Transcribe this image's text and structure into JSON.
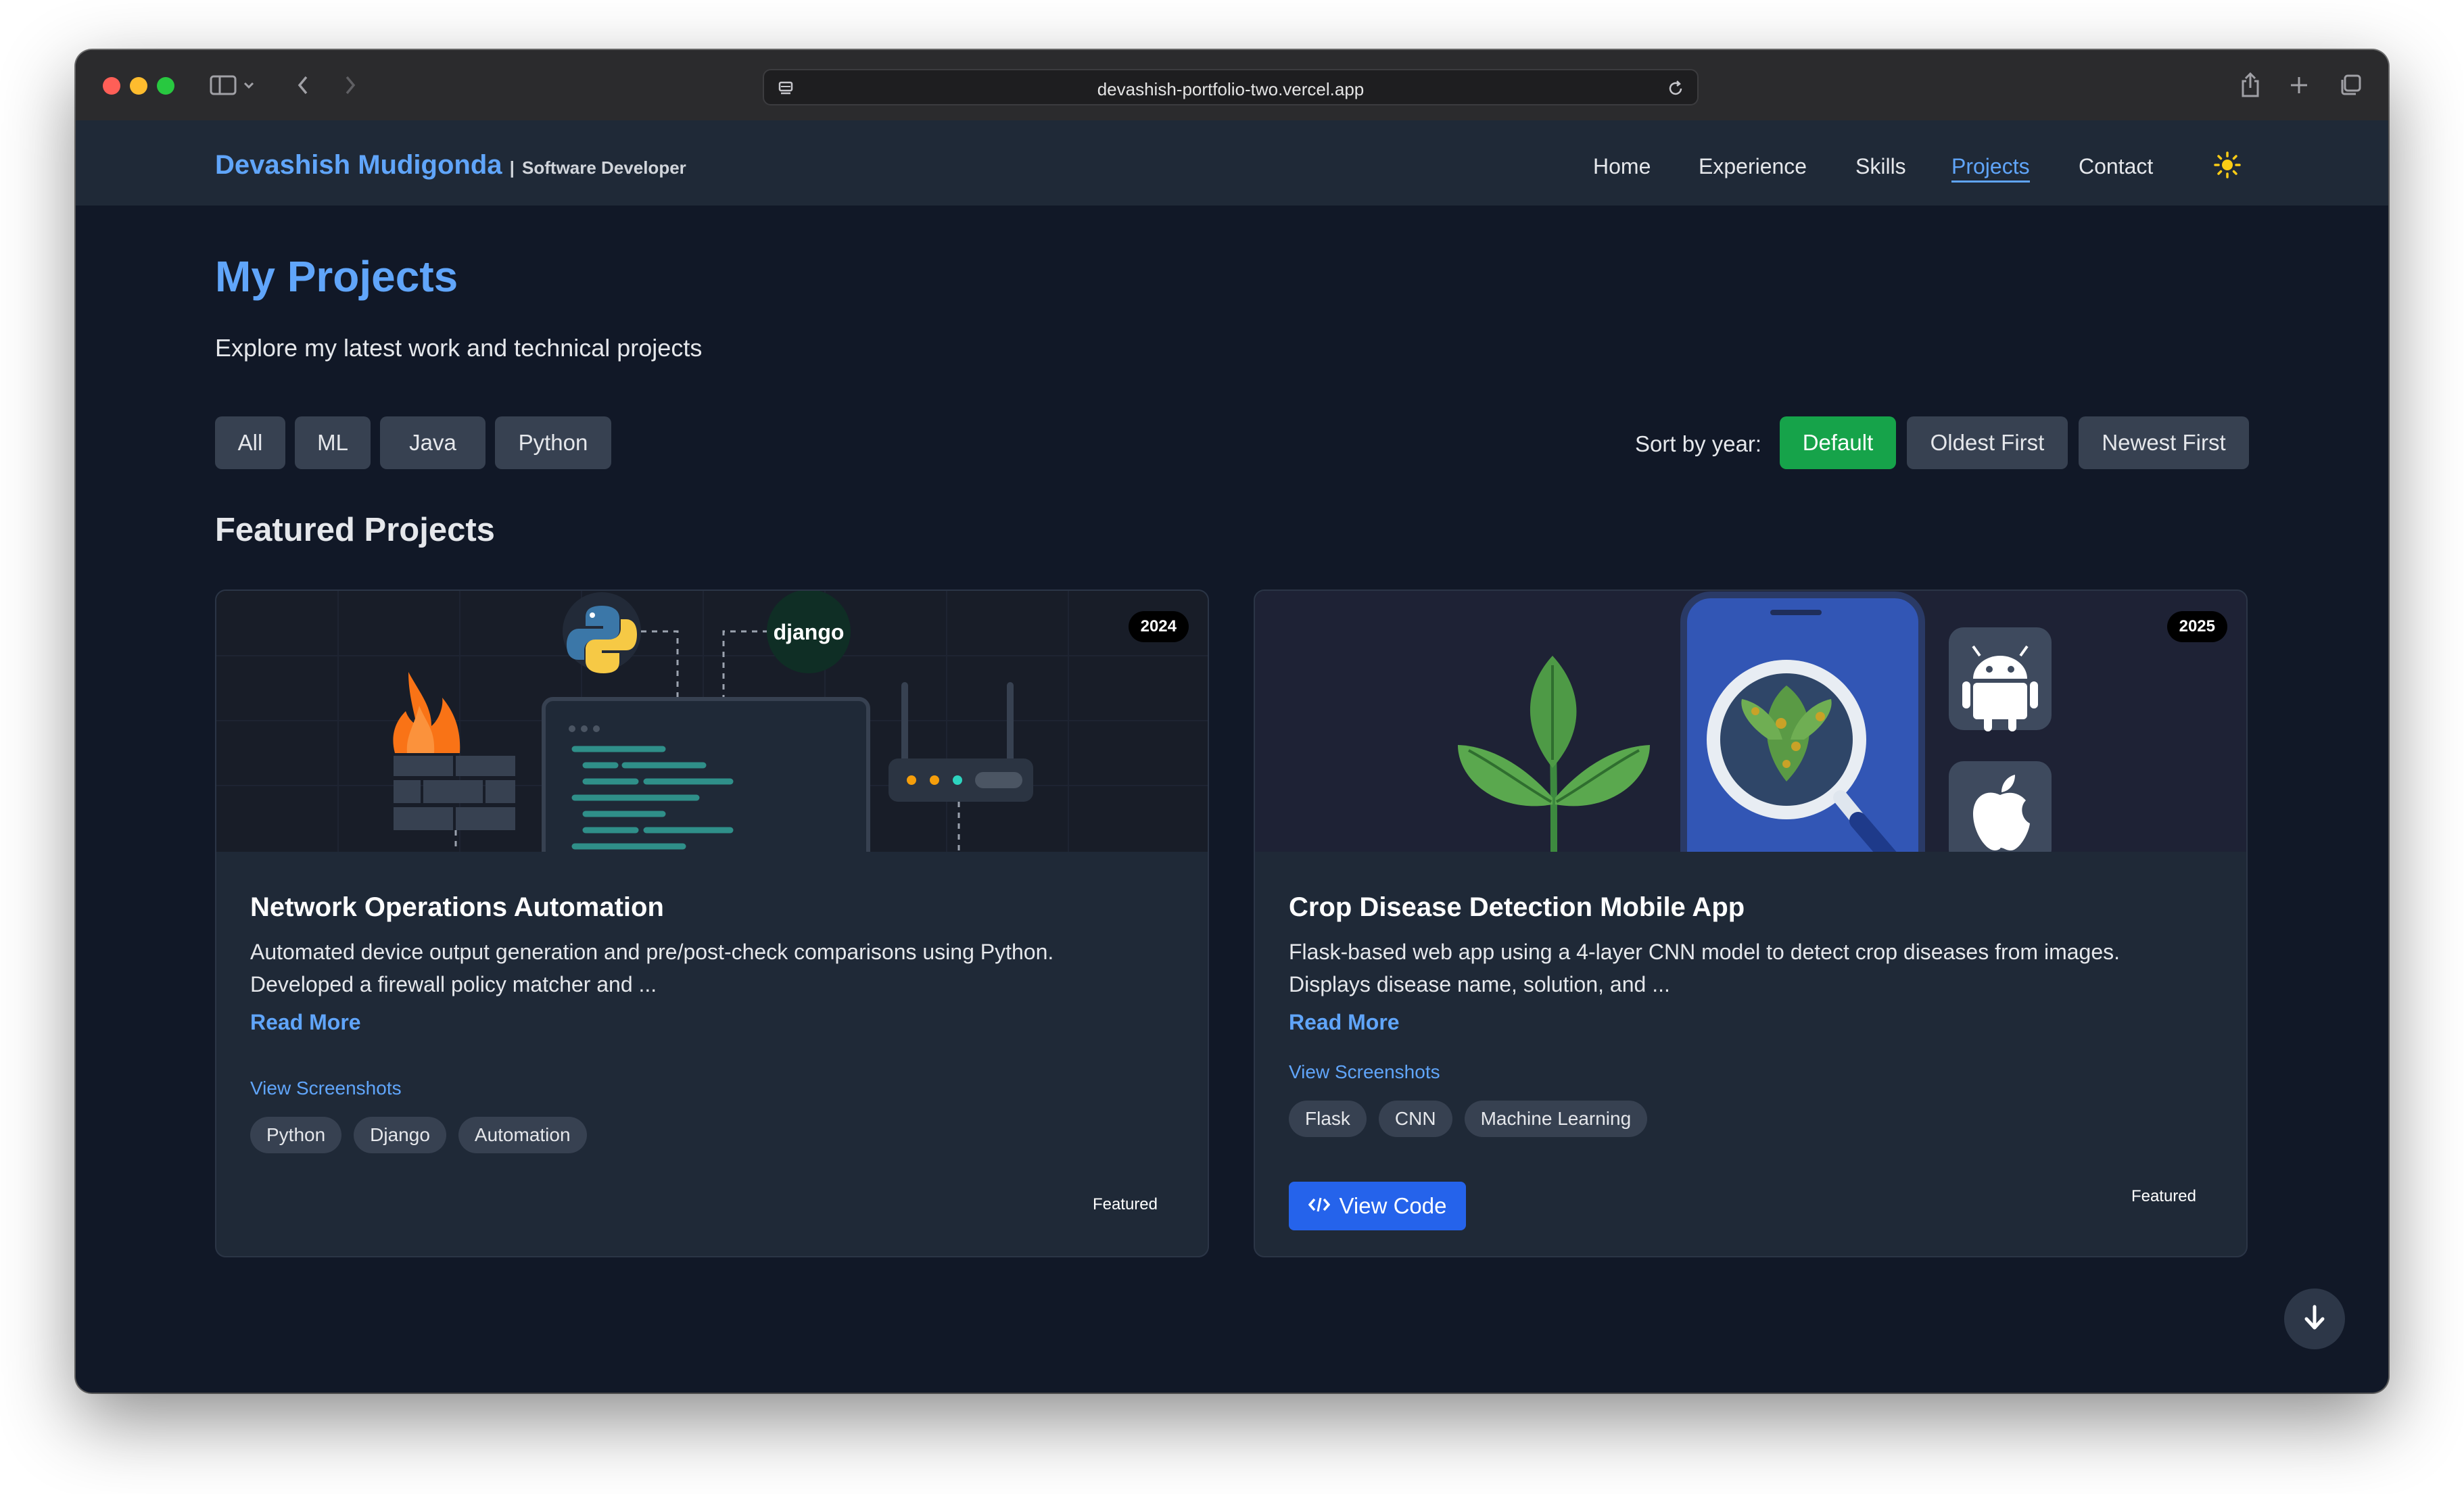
{
  "browser": {
    "url": "devashish-portfolio-two.vercel.app"
  },
  "nav": {
    "brand_name": "Devashish Mudigonda",
    "brand_separator": "|",
    "brand_role": "Software Developer",
    "links": [
      {
        "label": "Home",
        "active": false
      },
      {
        "label": "Experience",
        "active": false
      },
      {
        "label": "Skills",
        "active": false
      },
      {
        "label": "Projects",
        "active": true
      },
      {
        "label": "Contact",
        "active": false
      }
    ],
    "theme_icon": "sun-icon"
  },
  "page": {
    "title": "My Projects",
    "subtitle": "Explore my latest work and technical projects"
  },
  "filters": [
    "All",
    "ML",
    "Java",
    "Python"
  ],
  "sort": {
    "label": "Sort by year:",
    "options": [
      "Default",
      "Oldest First",
      "Newest First"
    ],
    "selected": "Default"
  },
  "section_title": "Featured Projects",
  "projects": [
    {
      "year": "2024",
      "title": "Network Operations Automation",
      "desc_line1": "Automated device output generation and pre/post-check comparisons using Python.",
      "desc_line2": "Developed a firewall policy matcher and ...",
      "read_more": "Read More",
      "screenshots": "View Screenshots",
      "tags": [
        "Python",
        "Django",
        "Automation"
      ],
      "featured": "Featured",
      "image_labels": {
        "framework_logo": "django"
      }
    },
    {
      "year": "2025",
      "title": "Crop Disease Detection Mobile App",
      "desc_line1": "Flask-based web app using a 4-layer CNN model to detect crop diseases from images.",
      "desc_line2": "Displays disease name, solution, and ...",
      "read_more": "Read More",
      "screenshots": "View Screenshots",
      "tags": [
        "Flask",
        "CNN",
        "Machine Learning"
      ],
      "view_code": "View Code",
      "featured": "Featured"
    }
  ],
  "colors": {
    "accent": "#60a5fa",
    "background": "#111827",
    "surface": "#1f2937",
    "chip": "#374151",
    "sort_selected": "#16a34a",
    "button_primary": "#2563eb"
  }
}
